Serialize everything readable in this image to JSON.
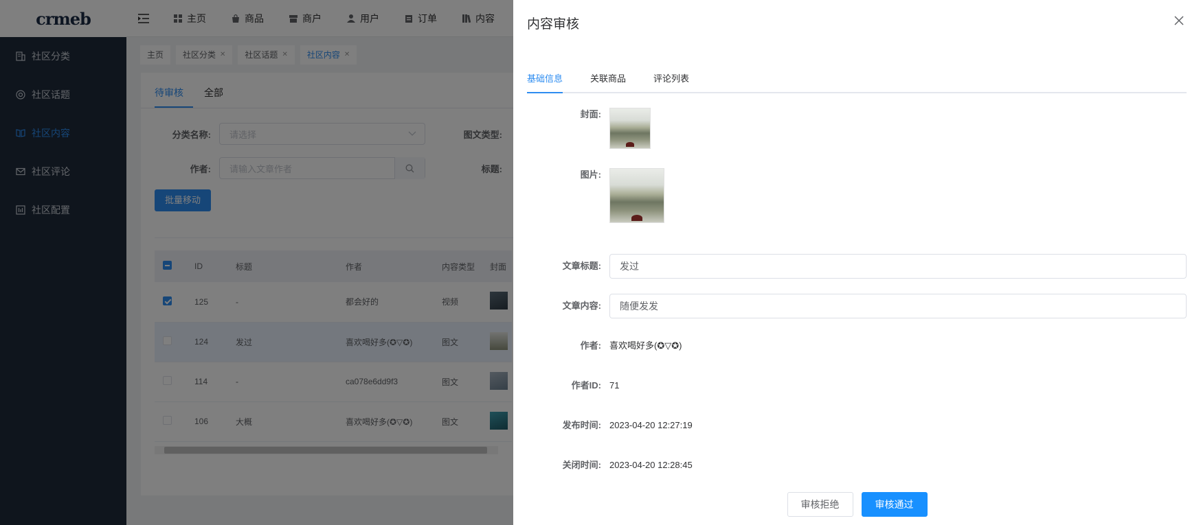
{
  "app": {
    "logo": "crmeb"
  },
  "sidebar": {
    "items": [
      {
        "label": "社区分类",
        "icon": "building-icon",
        "active": false
      },
      {
        "label": "社区话题",
        "icon": "lifebuoy-icon",
        "active": false
      },
      {
        "label": "社区内容",
        "icon": "book-open-icon",
        "active": true
      },
      {
        "label": "社区评论",
        "icon": "mail-icon",
        "active": false
      },
      {
        "label": "社区配置",
        "icon": "chart-icon",
        "active": false
      }
    ]
  },
  "topnav": {
    "items": [
      {
        "label": "主页",
        "icon": "grid-icon"
      },
      {
        "label": "商品",
        "icon": "bag-icon"
      },
      {
        "label": "商户",
        "icon": "store-icon"
      },
      {
        "label": "用户",
        "icon": "user-icon"
      },
      {
        "label": "订单",
        "icon": "clipboard-icon"
      },
      {
        "label": "内容",
        "icon": "library-icon"
      }
    ]
  },
  "tags": [
    {
      "label": "主页",
      "closable": false,
      "active": false
    },
    {
      "label": "社区分类",
      "closable": true,
      "active": false
    },
    {
      "label": "社区话题",
      "closable": true,
      "active": false
    },
    {
      "label": "社区内容",
      "closable": true,
      "active": true
    }
  ],
  "main": {
    "tabs": [
      {
        "label": "待审核",
        "active": true
      },
      {
        "label": "全部",
        "active": false
      }
    ],
    "filters": {
      "category_label": "分类名称:",
      "category_placeholder": "请选择",
      "type_label": "图文类型:",
      "author_label": "作者:",
      "author_placeholder": "请输入文章作者",
      "title_label": "标题:"
    },
    "batch_move": "批量移动",
    "table": {
      "columns": [
        "ID",
        "标题",
        "作者",
        "内容类型",
        "封面"
      ],
      "rows": [
        {
          "checked": true,
          "id": "125",
          "title": "-",
          "author": "都会好的",
          "type": "视频"
        },
        {
          "checked": false,
          "id": "124",
          "title": "发过",
          "author": "喜欢喝好多(✪▽✪)",
          "type": "图文"
        },
        {
          "checked": false,
          "id": "114",
          "title": "-",
          "author": "ca078e6dd9f3",
          "type": "图文"
        },
        {
          "checked": false,
          "id": "106",
          "title": "大概",
          "author": "喜欢喝好多(✪▽✪)",
          "type": "图文"
        }
      ]
    }
  },
  "drawer": {
    "title": "内容审核",
    "tabs": [
      {
        "label": "基础信息",
        "active": true
      },
      {
        "label": "关联商品",
        "active": false
      },
      {
        "label": "评论列表",
        "active": false
      }
    ],
    "fields": {
      "cover_label": "封面:",
      "images_label": "图片:",
      "article_title_label": "文章标题:",
      "article_title_value": "发过",
      "article_content_label": "文章内容:",
      "article_content_value": "随便发发",
      "author_label": "作者:",
      "author_value": "喜欢喝好多(✪▽✪)",
      "author_id_label": "作者ID:",
      "author_id_value": "71",
      "publish_time_label": "发布时间:",
      "publish_time_value": "2023-04-20 12:27:19",
      "close_time_label": "关闭时间:",
      "close_time_value": "2023-04-20 12:28:45"
    },
    "reject_button": "审核拒绝",
    "approve_button": "审核通过"
  },
  "colors": {
    "accent": "#2d8cf0",
    "primary_button": "#1890ff",
    "sidebar_bg": "#1f2a3a"
  }
}
